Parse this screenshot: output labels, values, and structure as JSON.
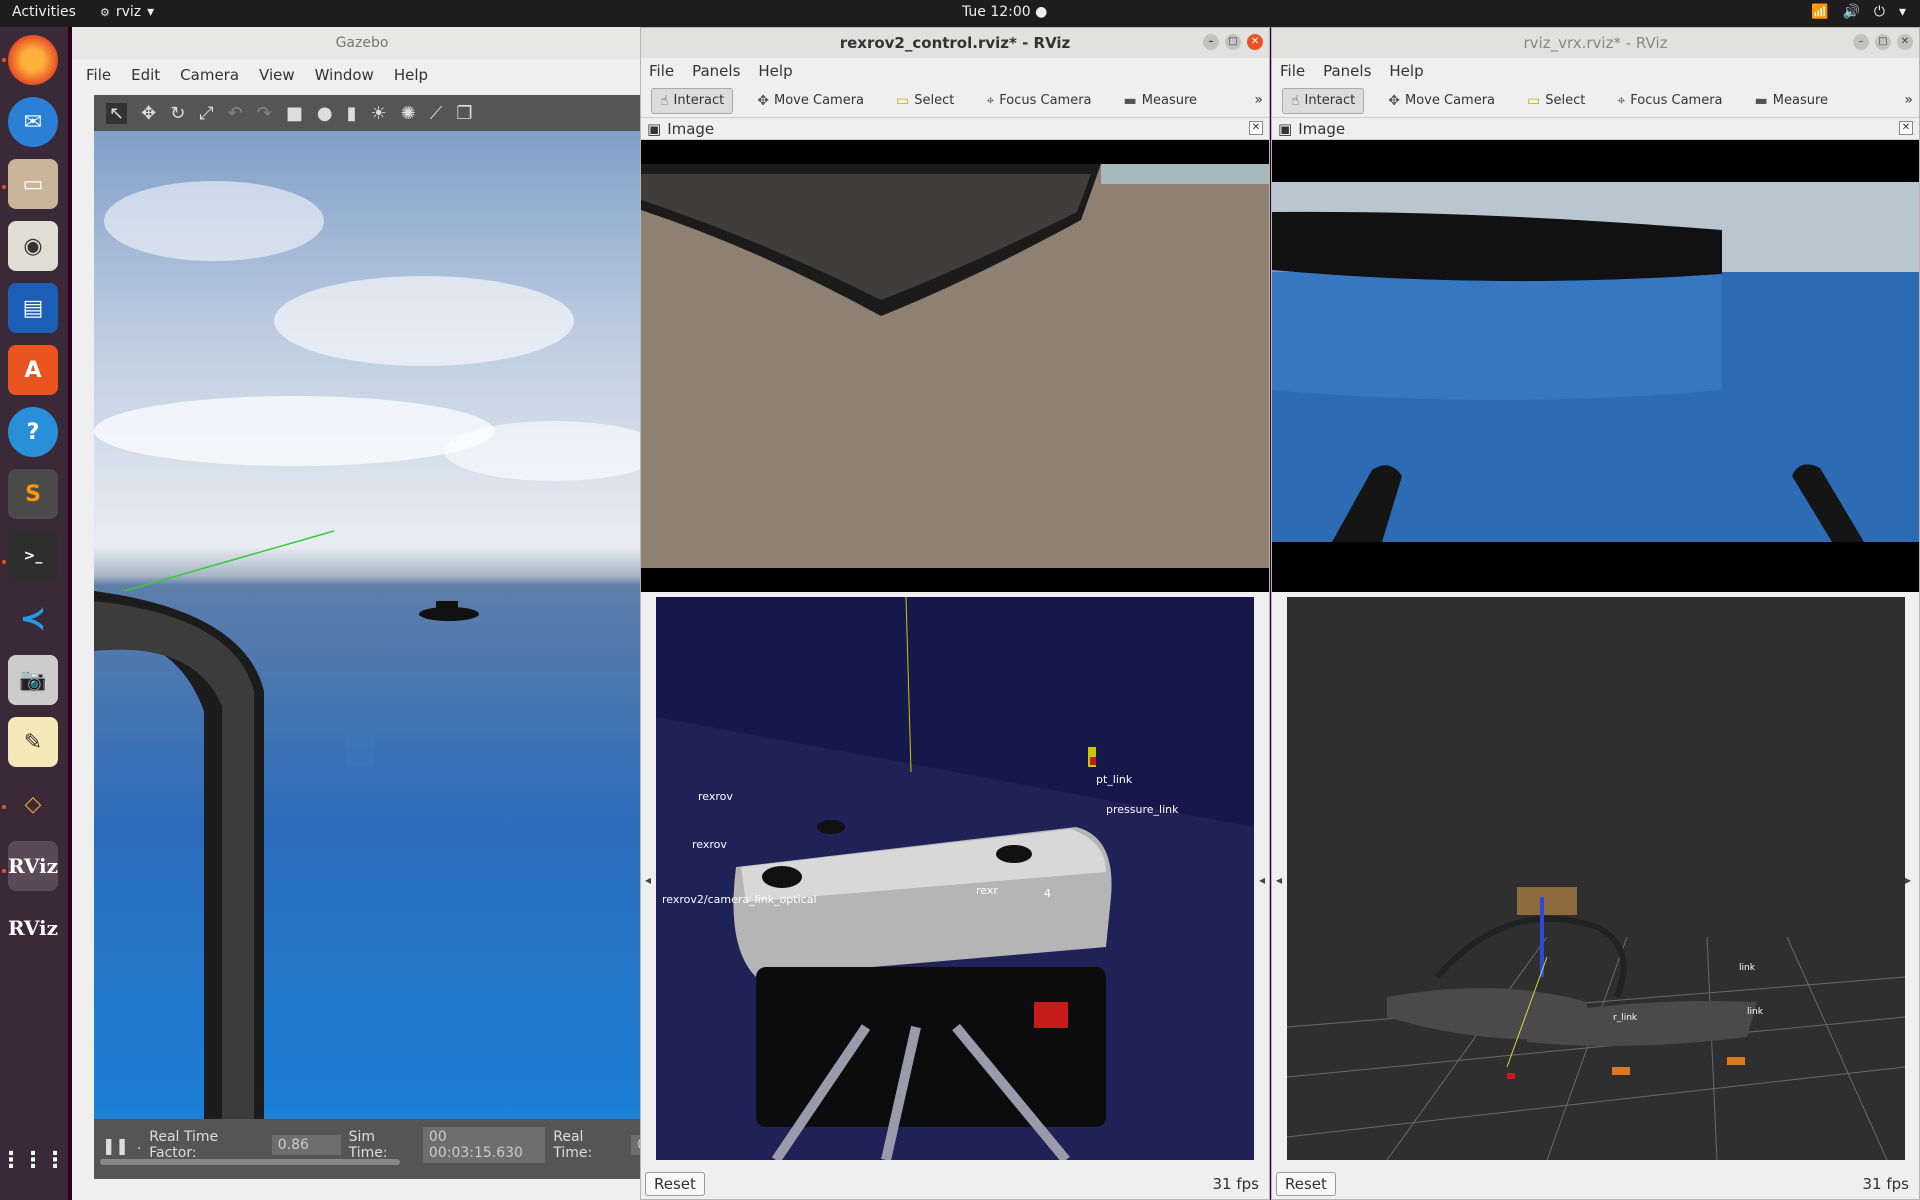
{
  "topbar": {
    "activities": "Activities",
    "app_name": "rviz",
    "clock": "Tue 12:00"
  },
  "dock": {
    "items": [
      "firefox-icon",
      "thunderbird-icon",
      "files-icon",
      "rhythmbox-icon",
      "writer-icon",
      "software-icon",
      "help-icon",
      "sublime-icon",
      "terminal-icon",
      "vscode-icon",
      "camera-icon",
      "text-editor-icon",
      "gazebo-icon",
      "rviz-icon",
      "rviz-icon"
    ],
    "rviz_label": "RViz"
  },
  "gazebo": {
    "title": "Gazebo",
    "menu": [
      "File",
      "Edit",
      "Camera",
      "View",
      "Window",
      "Help"
    ],
    "status": {
      "rtf_label": "Real Time Factor:",
      "rtf_value": "0.86",
      "sim_time_label": "Sim Time:",
      "sim_time_value": "00 00:03:15.630",
      "real_time_label": "Real Time:",
      "real_time_value": "0"
    }
  },
  "rviz1": {
    "title": "rexrov2_control.rviz* - RViz",
    "menu": [
      "File",
      "Panels",
      "Help"
    ],
    "tools": [
      "Interact",
      "Move Camera",
      "Select",
      "Focus Camera",
      "Measure"
    ],
    "panel_title": "Image",
    "reset": "Reset",
    "fps": "31 fps",
    "frame_labels": [
      "pt_link",
      "pressure_link",
      "rexrov",
      "rexrov",
      "rexrov2/camera_link_optical",
      "rexr",
      "4"
    ]
  },
  "rviz2": {
    "title": "rviz_vrx.rviz* - RViz",
    "menu": [
      "File",
      "Panels",
      "Help"
    ],
    "tools": [
      "Interact",
      "Move Camera",
      "Select",
      "Focus Camera",
      "Measure"
    ],
    "panel_title": "Image",
    "reset": "Reset",
    "fps": "31 fps",
    "frame_labels": [
      "r_link",
      "link",
      "link"
    ]
  },
  "colors": {
    "accent": "#e95420",
    "dock_bg": "#3a2a38",
    "topbar_bg": "#1d1d1d"
  }
}
